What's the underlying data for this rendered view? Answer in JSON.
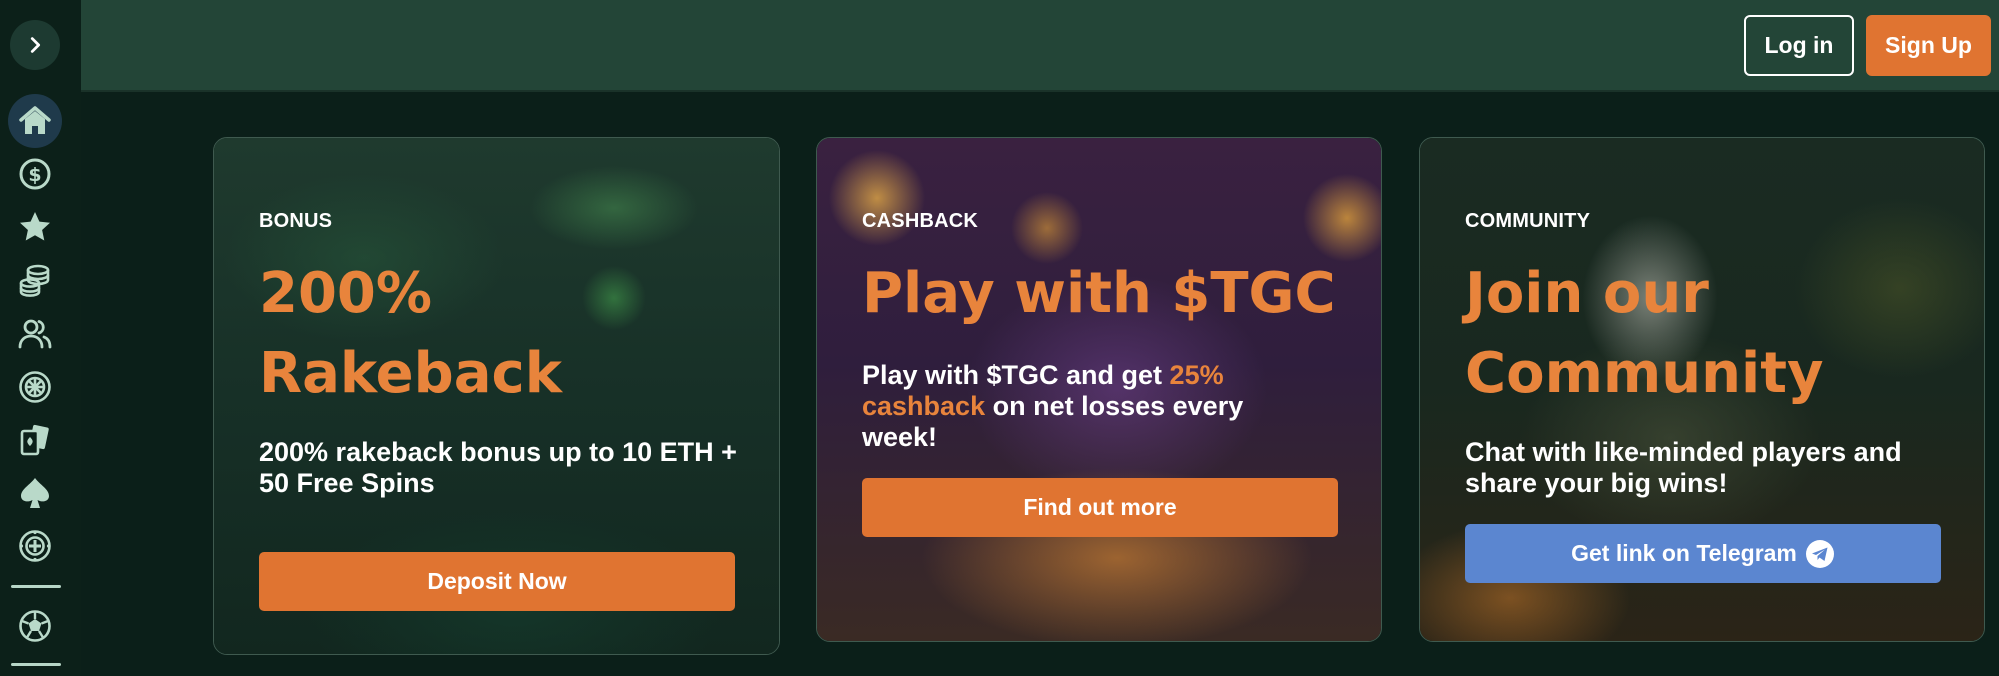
{
  "header": {
    "login_label": "Log in",
    "signup_label": "Sign Up"
  },
  "sidebar": {
    "items": [
      {
        "icon": "home-icon",
        "active": true
      },
      {
        "icon": "dollar-coin-icon",
        "active": false
      },
      {
        "icon": "star-icon",
        "active": false
      },
      {
        "icon": "coin-stack-icon",
        "active": false
      },
      {
        "icon": "users-icon",
        "active": false
      },
      {
        "icon": "wheel-icon",
        "active": false
      },
      {
        "icon": "cards-icon",
        "active": false
      },
      {
        "icon": "spade-icon",
        "active": false
      },
      {
        "icon": "roulette-icon",
        "active": false
      },
      {
        "icon": "soccer-ball-icon",
        "active": false
      }
    ]
  },
  "promos": [
    {
      "eyebrow": "BONUS",
      "headline": "200% Rakeback",
      "description": "200% rakeback bonus up to 10 ETH + 50 Free Spins",
      "cta_label": "Deposit Now"
    },
    {
      "eyebrow": "CASHBACK",
      "headline": "Play with $TGC",
      "description_before": "Play with $TGC and get ",
      "description_highlight": "25% cashback",
      "description_after": " on net losses every week!",
      "cta_label": "Find out more"
    },
    {
      "eyebrow": "COMMUNITY",
      "headline": "Join our Community",
      "description": "Chat with like-minded players and share your big wins!",
      "cta_label": "Get link on Telegram"
    }
  ],
  "colors": {
    "accent_orange": "#e07431",
    "headline_orange": "#e8843c",
    "telegram_blue": "#5b86d0",
    "header_bg": "#234537",
    "page_bg": "#0b1f19"
  }
}
